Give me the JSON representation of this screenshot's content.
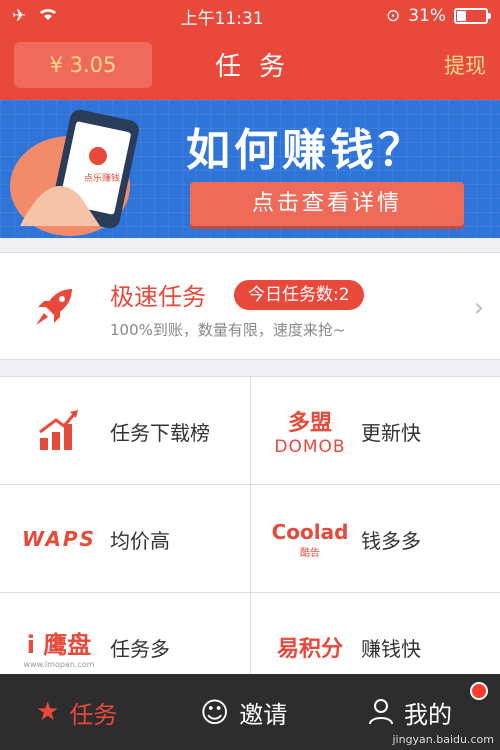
{
  "status": {
    "time": "上午11:31",
    "battery": "31%"
  },
  "nav": {
    "balance": "¥ 3.05",
    "title": "任务",
    "withdraw": "提现"
  },
  "banner": {
    "title": "如何赚钱？",
    "button": "点击查看详情",
    "phone_text": "点乐赚钱"
  },
  "quick": {
    "title": "极速任务",
    "badge": "今日任务数:2",
    "subtitle": "100%到账，数量有限，速度来抢~"
  },
  "grid": [
    {
      "label": "任务下载榜",
      "logo_text": ""
    },
    {
      "label": "更新快",
      "logo_text": "多盟",
      "logo_sub": "DOMOB"
    },
    {
      "label": "均价高",
      "logo_text": "WAPS"
    },
    {
      "label": "钱多多",
      "logo_text": "Coolad",
      "logo_sub": "酷告"
    },
    {
      "label": "任务多",
      "logo_text": "i 鹰盘",
      "logo_sub": "www.imopan.com"
    },
    {
      "label": "赚钱快",
      "logo_text": "易积分"
    }
  ],
  "tabs": [
    {
      "label": "任务"
    },
    {
      "label": "邀请"
    },
    {
      "label": "我的"
    }
  ],
  "watermark": "jingyan.baidu.com",
  "colors": {
    "primary": "#e8493a",
    "banner": "#2f74d9",
    "tabbar": "#2d2d2d",
    "gold": "#ffd98a"
  }
}
